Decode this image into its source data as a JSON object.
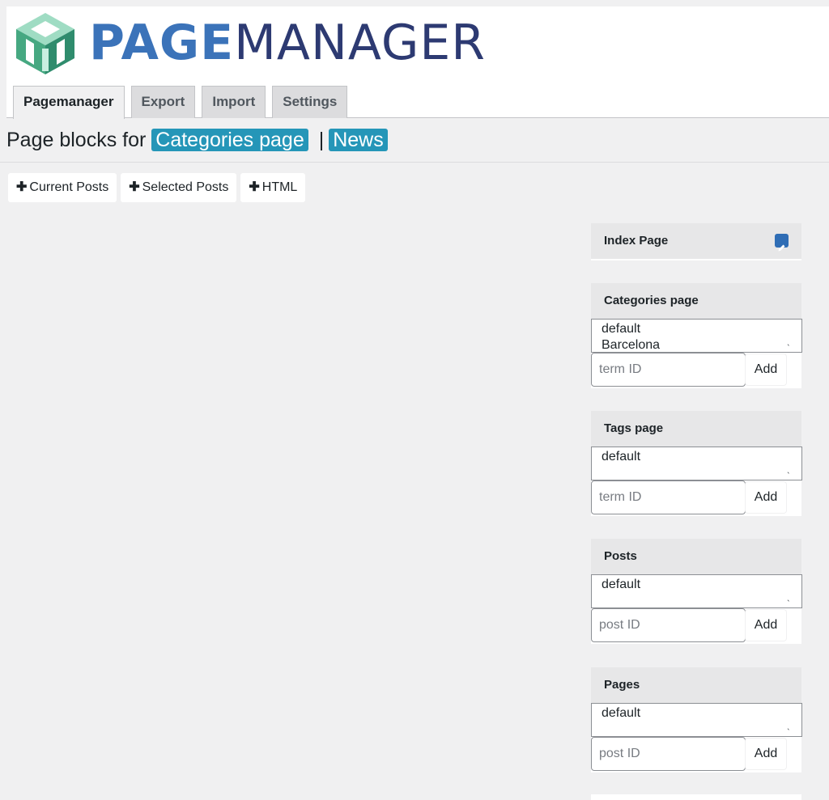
{
  "brand": {
    "part1": "PAGE",
    "part2": "MANAGER"
  },
  "tabs": [
    "Pagemanager",
    "Export",
    "Import",
    "Settings"
  ],
  "heading": {
    "prefix": "Page blocks for",
    "primary": "Categories page",
    "separator": "|",
    "secondary": "News"
  },
  "add_buttons": [
    "Current Posts",
    "Selected Posts",
    "HTML"
  ],
  "panels": {
    "index": {
      "title": "Index Page"
    },
    "categories": {
      "title": "Categories page",
      "options": [
        "default",
        "Barcelona"
      ],
      "placeholder": "term ID",
      "add": "Add"
    },
    "tags": {
      "title": "Tags page",
      "options": [
        "default"
      ],
      "placeholder": "term ID",
      "add": "Add"
    },
    "posts": {
      "title": "Posts",
      "options": [
        "default"
      ],
      "placeholder": "post ID",
      "add": "Add"
    },
    "pages": {
      "title": "Pages",
      "options": [
        "default"
      ],
      "placeholder": "post ID",
      "add": "Add"
    }
  },
  "colors": {
    "accent": "#2596b8",
    "brand_blue": "#3b73b9",
    "brand_navy": "#2d3a72",
    "logo_green": "#46a881",
    "edit_icon": "#2f6db5"
  }
}
